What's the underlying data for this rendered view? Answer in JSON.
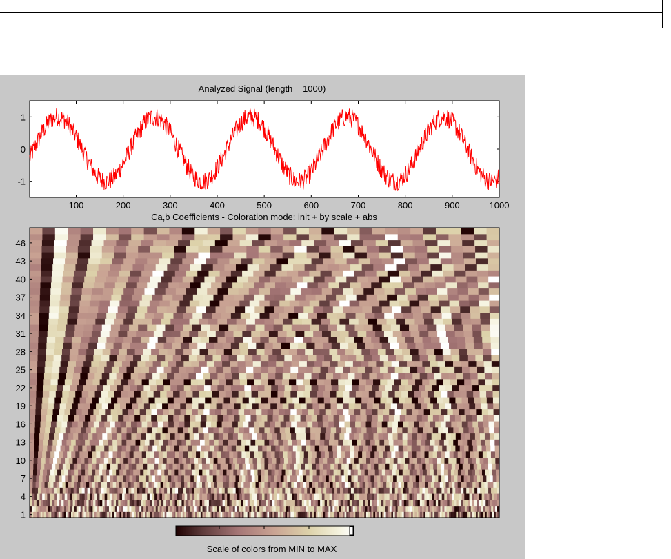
{
  "window": {
    "accent_colors": {
      "figure_bg": "#c8c8c8",
      "signal": "#ff0000"
    }
  },
  "chart_data": [
    {
      "type": "line",
      "title": "Analyzed Signal (length = 1000)",
      "xlabel": "",
      "ylabel": "",
      "xlim": [
        1,
        1000
      ],
      "ylim": [
        -1.5,
        1.5
      ],
      "x_ticks": [
        100,
        200,
        300,
        400,
        500,
        600,
        700,
        800,
        900,
        1000
      ],
      "y_ticks": [
        1,
        0,
        -1
      ],
      "grid": false,
      "series": [
        {
          "color": "#ff0000",
          "length": 1000,
          "period": 205,
          "amplitude": 1.0,
          "noise_amplitude": 0.3
        }
      ]
    },
    {
      "type": "heatmap",
      "title": "Ca,b Coefficients - Coloration mode: init + by scale + abs",
      "xlabel": "",
      "ylabel": "",
      "xlim": [
        1,
        1000
      ],
      "ylim": [
        1,
        48
      ],
      "y_ticks": [
        1,
        4,
        7,
        10,
        13,
        16,
        19,
        22,
        25,
        28,
        31,
        34,
        37,
        40,
        43,
        46
      ],
      "colormap": "pink",
      "colorbar": {
        "label": "Scale of colors from MIN to MAX"
      }
    }
  ]
}
